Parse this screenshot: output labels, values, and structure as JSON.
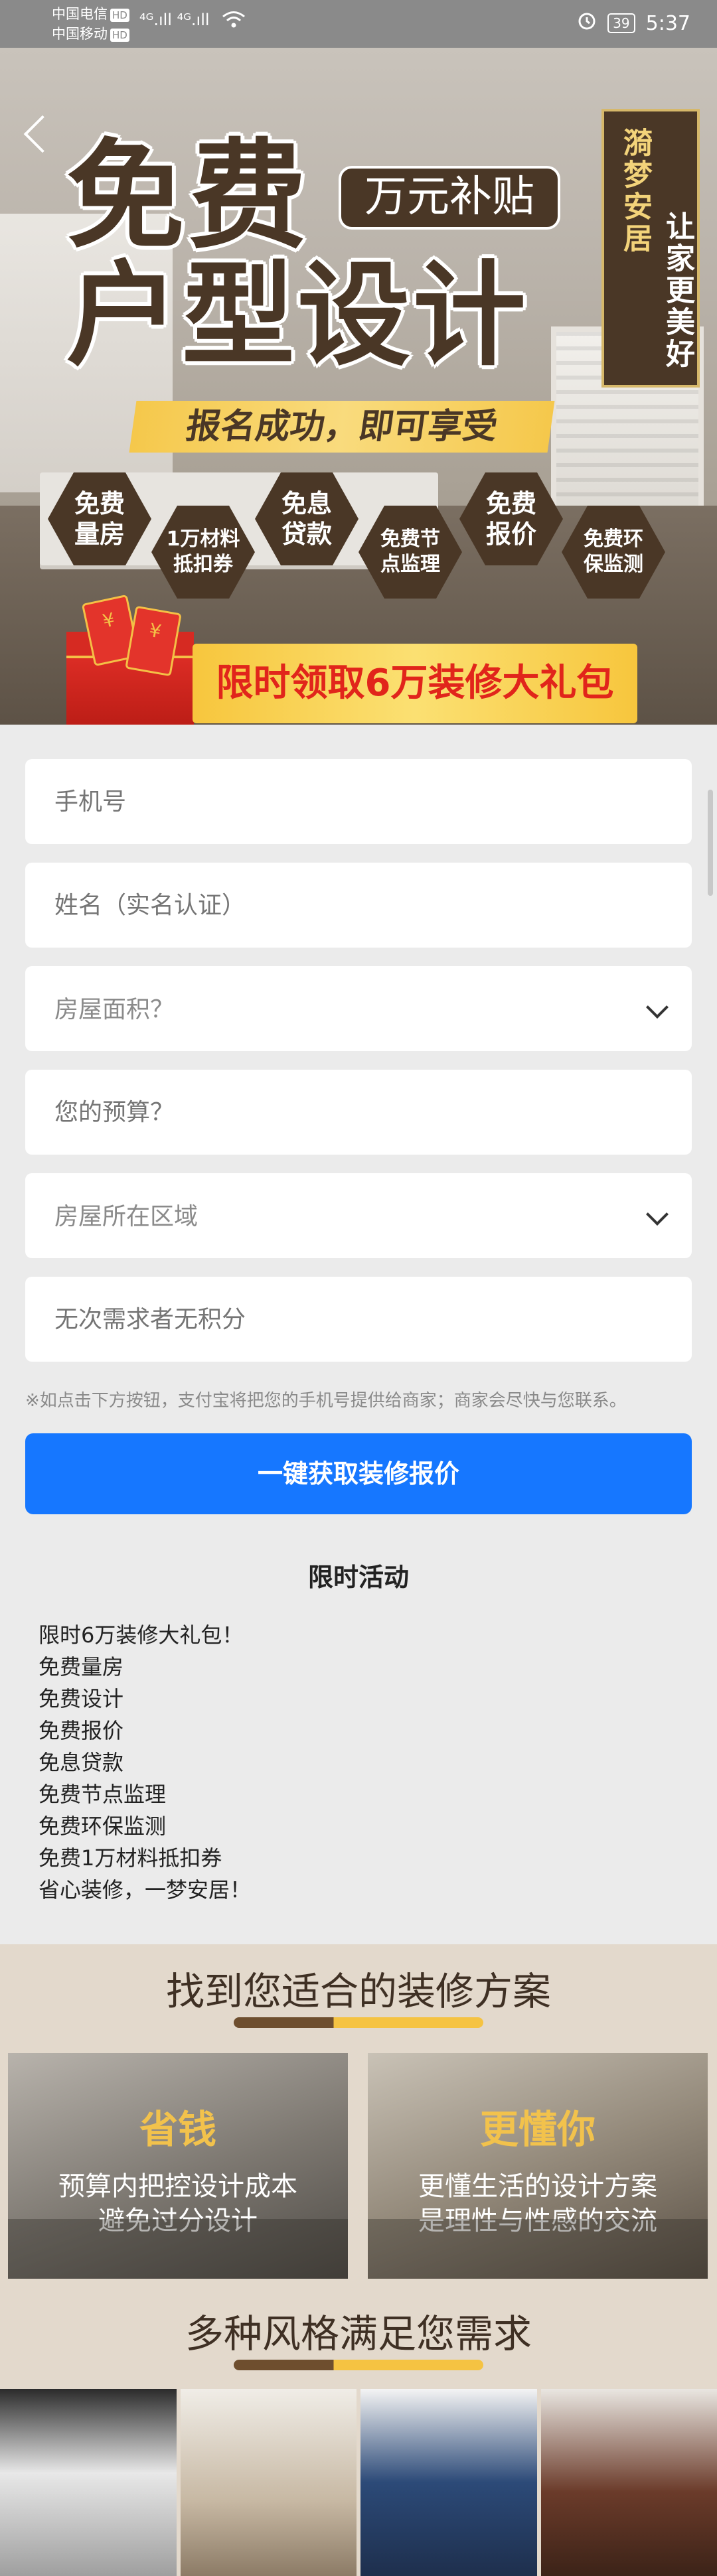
{
  "status_bar": {
    "carrier1": "中国电信",
    "carrier2": "中国移动",
    "hd": "HD",
    "signal": "⁴ᴳ.ıll ⁴ᴳ.ıll",
    "battery": "39",
    "time": "5:37"
  },
  "hero": {
    "title_line1": "免费",
    "title_line2": "户型设计",
    "subsidy": "万元补贴",
    "brand_col1": "漪梦安居",
    "brand_col2": "让家更美好",
    "signup": "报名成功，即可享受",
    "benefits": [
      {
        "l1": "免费",
        "l2": "量房"
      },
      {
        "l1": "1万材料",
        "l2": "抵扣券"
      },
      {
        "l1": "免息",
        "l2": "贷款"
      },
      {
        "l1": "免费节",
        "l2": "点监理"
      },
      {
        "l1": "免费",
        "l2": "报价"
      },
      {
        "l1": "免费环",
        "l2": "保监测"
      }
    ],
    "envelope1": "¥",
    "envelope2": "¥",
    "gift": "限时领取6万装修大礼包"
  },
  "form": {
    "phone_placeholder": "手机号",
    "name_placeholder": "姓名（实名认证）",
    "area_placeholder": "房屋面积？",
    "budget_placeholder": "您的预算？",
    "region_placeholder": "房屋所在区域",
    "extra_placeholder": "无次需求者无积分",
    "notice": "※如点击下方按钮，支付宝将把您的手机号提供给商家；商家会尽快与您联系。",
    "submit": "一键获取装修报价"
  },
  "activity": {
    "title": "限时活动",
    "items": [
      "限时6万装修大礼包！",
      "免费量房",
      "免费设计",
      "免费报价",
      "免息贷款",
      "免费节点监理",
      "免费环保监测",
      "免费1万材料抵扣券",
      "省心装修，一梦安居！"
    ]
  },
  "plan": {
    "title": "找到您适合的装修方案",
    "cards": [
      {
        "title": "省钱",
        "line1": "预算内把控设计成本",
        "line2": "避免过分设计"
      },
      {
        "title": "更懂你",
        "line1": "更懂生活的设计方案",
        "line2": "是理性与性感的交流"
      }
    ],
    "styles_title": "多种风格满足您需求"
  },
  "colors": {
    "brand_brown": "#4a3726",
    "accent_gold": "#f5c84b",
    "cta_blue": "#1677ff",
    "gift_red": "#e1251b"
  }
}
